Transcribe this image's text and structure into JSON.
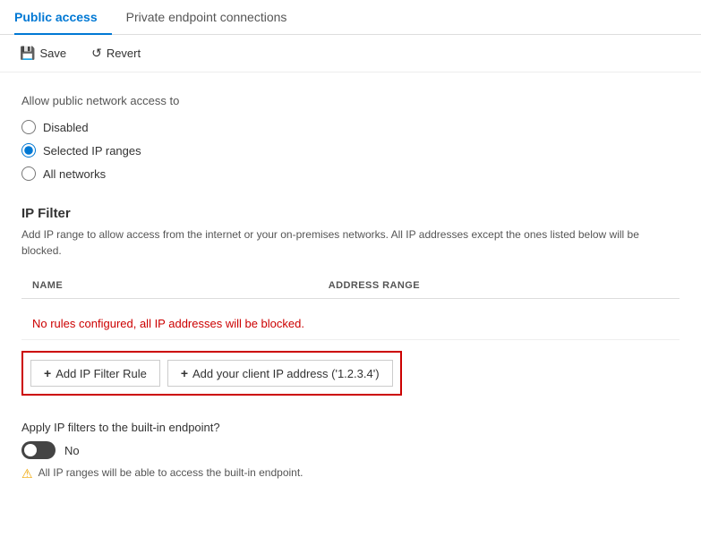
{
  "tabs": [
    {
      "id": "public-access",
      "label": "Public access",
      "active": true
    },
    {
      "id": "private-endpoint",
      "label": "Private endpoint connections",
      "active": false
    }
  ],
  "toolbar": {
    "save_label": "Save",
    "revert_label": "Revert"
  },
  "main": {
    "access_label": "Allow public network access to",
    "radio_options": [
      {
        "id": "disabled",
        "label": "Disabled",
        "checked": false
      },
      {
        "id": "selected-ip-ranges",
        "label": "Selected IP ranges",
        "checked": true
      },
      {
        "id": "all-networks",
        "label": "All networks",
        "checked": false
      }
    ],
    "ip_filter": {
      "title": "IP Filter",
      "description": "Add IP range to allow access from the internet or your on-premises networks. All IP addresses except the ones listed below will be blocked.",
      "table": {
        "columns": [
          "NAME",
          "ADDRESS RANGE"
        ],
        "rows": []
      },
      "no_rules_message": "No rules configured, all IP addresses will be blocked.",
      "add_rule_btn": "Add IP Filter Rule",
      "add_client_ip_btn": "Add your client IP address ('1.2.3.4')"
    },
    "apply_section": {
      "label": "Apply IP filters to the built-in endpoint?",
      "toggle_value": false,
      "toggle_label": "No",
      "warning_text": "All IP ranges will be able to access the built-in endpoint."
    }
  },
  "icons": {
    "save": "💾",
    "revert": "↺",
    "plus": "+",
    "warning": "⚠"
  }
}
